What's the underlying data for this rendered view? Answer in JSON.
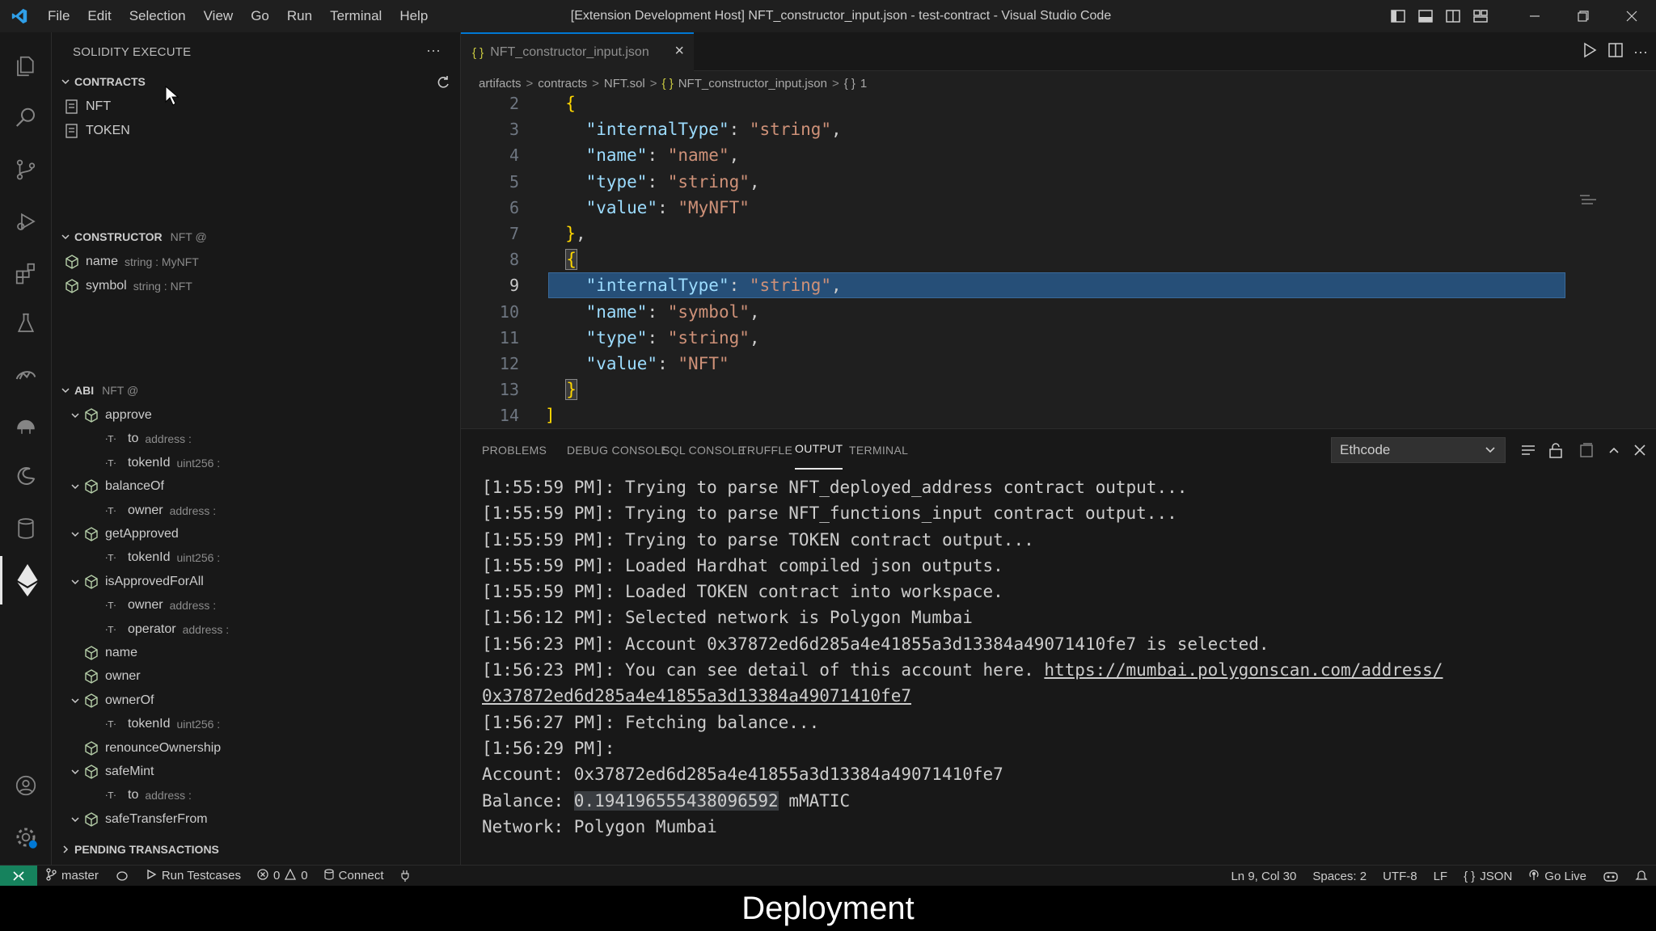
{
  "window": {
    "title": "[Extension Development Host] NFT_constructor_input.json - test-contract - Visual Studio Code",
    "menu": [
      "File",
      "Edit",
      "Selection",
      "View",
      "Go",
      "Run",
      "Terminal",
      "Help"
    ]
  },
  "sidebar": {
    "header": "SOLIDITY EXECUTE",
    "contracts": {
      "title": "CONTRACTS",
      "items": [
        "NFT",
        "TOKEN"
      ]
    },
    "constructor": {
      "title": "CONSTRUCTOR",
      "subtitle": "NFT @",
      "items": [
        {
          "name": "name",
          "desc": "string : MyNFT"
        },
        {
          "name": "symbol",
          "desc": "string : NFT"
        }
      ]
    },
    "abi": {
      "title": "ABI",
      "subtitle": "NFT @",
      "rows": [
        {
          "label": "approve",
          "desc": "",
          "level": 1,
          "kind": "fn"
        },
        {
          "label": "to",
          "desc": "address :",
          "level": 2,
          "kind": "param"
        },
        {
          "label": "tokenId",
          "desc": "uint256 :",
          "level": 2,
          "kind": "param"
        },
        {
          "label": "balanceOf",
          "desc": "",
          "level": 1,
          "kind": "fn"
        },
        {
          "label": "owner",
          "desc": "address :",
          "level": 2,
          "kind": "param"
        },
        {
          "label": "getApproved",
          "desc": "",
          "level": 1,
          "kind": "fn"
        },
        {
          "label": "tokenId",
          "desc": "uint256 :",
          "level": 2,
          "kind": "param"
        },
        {
          "label": "isApprovedForAll",
          "desc": "",
          "level": 1,
          "kind": "fn"
        },
        {
          "label": "owner",
          "desc": "address :",
          "level": 2,
          "kind": "param"
        },
        {
          "label": "operator",
          "desc": "address :",
          "level": 2,
          "kind": "param"
        },
        {
          "label": "name",
          "desc": "",
          "level": 1,
          "kind": "leaf"
        },
        {
          "label": "owner",
          "desc": "",
          "level": 1,
          "kind": "leaf"
        },
        {
          "label": "ownerOf",
          "desc": "",
          "level": 1,
          "kind": "fn"
        },
        {
          "label": "tokenId",
          "desc": "uint256 :",
          "level": 2,
          "kind": "param"
        },
        {
          "label": "renounceOwnership",
          "desc": "",
          "level": 1,
          "kind": "leaf"
        },
        {
          "label": "safeMint",
          "desc": "",
          "level": 1,
          "kind": "fn"
        },
        {
          "label": "to",
          "desc": "address :",
          "level": 2,
          "kind": "param"
        },
        {
          "label": "safeTransferFrom",
          "desc": "",
          "level": 1,
          "kind": "fn"
        }
      ]
    },
    "pending": {
      "title": "PENDING TRANSACTIONS"
    }
  },
  "editor": {
    "tab_label": "NFT_constructor_input.json",
    "tab_icon": "{ }",
    "breadcrumb": [
      "artifacts",
      "contracts",
      "NFT.sol",
      "NFT_constructor_input.json",
      "1"
    ],
    "breadcrumb_json_icon": "{ }",
    "lines": [
      {
        "n": "2",
        "tokens": [
          {
            "t": "  ",
            "c": ""
          },
          {
            "t": "{",
            "c": "br"
          }
        ]
      },
      {
        "n": "3",
        "tokens": [
          {
            "t": "    ",
            "c": ""
          },
          {
            "t": "\"internalType\"",
            "c": "k"
          },
          {
            "t": ": ",
            "c": ""
          },
          {
            "t": "\"string\"",
            "c": "s"
          },
          {
            "t": ",",
            "c": ""
          }
        ]
      },
      {
        "n": "4",
        "tokens": [
          {
            "t": "    ",
            "c": ""
          },
          {
            "t": "\"name\"",
            "c": "k"
          },
          {
            "t": ": ",
            "c": ""
          },
          {
            "t": "\"name\"",
            "c": "s"
          },
          {
            "t": ",",
            "c": ""
          }
        ]
      },
      {
        "n": "5",
        "tokens": [
          {
            "t": "    ",
            "c": ""
          },
          {
            "t": "\"type\"",
            "c": "k"
          },
          {
            "t": ": ",
            "c": ""
          },
          {
            "t": "\"string\"",
            "c": "s"
          },
          {
            "t": ",",
            "c": ""
          }
        ]
      },
      {
        "n": "6",
        "tokens": [
          {
            "t": "    ",
            "c": ""
          },
          {
            "t": "\"value\"",
            "c": "k"
          },
          {
            "t": ": ",
            "c": ""
          },
          {
            "t": "\"MyNFT\"",
            "c": "s"
          }
        ]
      },
      {
        "n": "7",
        "tokens": [
          {
            "t": "  ",
            "c": ""
          },
          {
            "t": "}",
            "c": "br"
          },
          {
            "t": ",",
            "c": ""
          }
        ]
      },
      {
        "n": "8",
        "tokens": [
          {
            "t": "  ",
            "c": ""
          },
          {
            "t": "{",
            "c": "br box"
          }
        ]
      },
      {
        "n": "9",
        "tokens": [
          {
            "t": "    ",
            "c": ""
          },
          {
            "t": "\"internalType\"",
            "c": "k"
          },
          {
            "t": ": ",
            "c": ""
          },
          {
            "t": "\"string\"",
            "c": "s"
          },
          {
            "t": ",",
            "c": ""
          }
        ],
        "current": true
      },
      {
        "n": "10",
        "tokens": [
          {
            "t": "    ",
            "c": ""
          },
          {
            "t": "\"name\"",
            "c": "k"
          },
          {
            "t": ": ",
            "c": ""
          },
          {
            "t": "\"symbol\"",
            "c": "s"
          },
          {
            "t": ",",
            "c": ""
          }
        ]
      },
      {
        "n": "11",
        "tokens": [
          {
            "t": "    ",
            "c": ""
          },
          {
            "t": "\"type\"",
            "c": "k"
          },
          {
            "t": ": ",
            "c": ""
          },
          {
            "t": "\"string\"",
            "c": "s"
          },
          {
            "t": ",",
            "c": ""
          }
        ]
      },
      {
        "n": "12",
        "tokens": [
          {
            "t": "    ",
            "c": ""
          },
          {
            "t": "\"value\"",
            "c": "k"
          },
          {
            "t": ": ",
            "c": ""
          },
          {
            "t": "\"NFT\"",
            "c": "s"
          }
        ]
      },
      {
        "n": "13",
        "tokens": [
          {
            "t": "  ",
            "c": ""
          },
          {
            "t": "}",
            "c": "br box"
          }
        ]
      },
      {
        "n": "14",
        "tokens": [
          {
            "t": "]",
            "c": "br"
          }
        ]
      }
    ]
  },
  "panel": {
    "tabs": [
      "PROBLEMS",
      "DEBUG CONSOLE",
      "SQL CONSOLE",
      "TRUFFLE",
      "OUTPUT",
      "TERMINAL"
    ],
    "active_tab": "OUTPUT",
    "channel": "Ethcode",
    "output_lines": [
      [
        {
          "t": "[1:55:59 PM]: Trying to parse NFT_deployed_address contract output..."
        }
      ],
      [
        {
          "t": "[1:55:59 PM]: Trying to parse NFT_functions_input contract output..."
        }
      ],
      [
        {
          "t": "[1:55:59 PM]: Trying to parse TOKEN contract output..."
        }
      ],
      [
        {
          "t": "[1:55:59 PM]: Loaded Hardhat compiled json outputs."
        }
      ],
      [
        {
          "t": "[1:55:59 PM]: Loaded TOKEN contract into workspace."
        }
      ],
      [
        {
          "t": "[1:56:12 PM]: Selected network is Polygon Mumbai"
        }
      ],
      [
        {
          "t": "[1:56:23 PM]: Account 0x37872ed6d285a4e41855a3d13384a49071410fe7 is selected."
        }
      ],
      [
        {
          "t": "[1:56:23 PM]: You can see detail of this account here. "
        },
        {
          "t": "https://mumbai.polygonscan.com/address/",
          "link": true
        }
      ],
      [
        {
          "t": "0x37872ed6d285a4e41855a3d13384a49071410fe7",
          "link": true
        }
      ],
      [
        {
          "t": "[1:56:27 PM]: Fetching balance..."
        }
      ],
      [
        {
          "t": "[1:56:29 PM]:"
        }
      ],
      [
        {
          "t": "Account: 0x37872ed6d285a4e41855a3d13384a49071410fe7"
        }
      ],
      [
        {
          "t": "Balance: "
        },
        {
          "t": "0.194196555438096592",
          "hl": true
        },
        {
          "t": " mMATIC"
        }
      ],
      [
        {
          "t": "Network: Polygon Mumbai"
        }
      ]
    ]
  },
  "statusbar": {
    "branch": "master",
    "run_testcases": "Run Testcases",
    "errors": "0",
    "warnings": "0",
    "connect": "Connect",
    "position": "Ln 9, Col 30",
    "spaces": "Spaces: 2",
    "encoding": "UTF-8",
    "eol": "LF",
    "language": "JSON",
    "language_icon": "{ }",
    "go_live": "Go Live"
  },
  "caption": "Deployment",
  "colors": {
    "accent": "#0078d4",
    "remote_bg": "#16825d",
    "editor_bg": "#1f1f1f",
    "json_key": "#9cdcfe",
    "json_string": "#ce9178",
    "bracket": "#ffd700",
    "selection": "#264f78"
  }
}
